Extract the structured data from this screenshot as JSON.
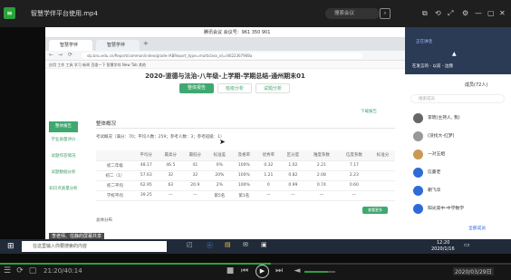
{
  "player": {
    "title": "智慧学伴平台使用.mp4",
    "right_field": "搜索会议",
    "elapsed": "21:20/40:14",
    "volume_pct": 75,
    "progress_pct": 53,
    "stamp": "2020/03/29日"
  },
  "meeting": {
    "title": "腾讯会议 会议号：961 350 901",
    "badge": "正在讲话"
  },
  "browser": {
    "tab1": "智慧学伴",
    "tab2": "智慧学伴",
    "url": "slp.bnu.edu.cn/Report/common/index/grade-/ABReport_type=multiclass_id=/4622367908a",
    "bookmarks": "应用  工作  工具  学习  新闻  百度一下  智慧学伴  New Tab  其他",
    "page_title": "2020-道德与法治-八年级-上学期-学期总结-通州期末01",
    "buttons": [
      "整体报告",
      "班级分析",
      "试题分析"
    ],
    "download": "下载报告",
    "side": [
      "整体报告",
      "学业质量评价",
      "试题作答情况",
      "试题数据分析",
      "知识点质量分析"
    ],
    "section": "整体概况",
    "summary": "考试概况（满分：70；平均人数：259；参考人数：3；参考班级：1）",
    "footer_label": "总体分布",
    "footer_btn": "查看更多"
  },
  "table": {
    "headers": [
      "",
      "平均分",
      "最高分",
      "最低分",
      "标准差",
      "及格率",
      "优秀率",
      "区分度",
      "难度系数",
      "信度系数",
      "标准分"
    ],
    "rows": [
      [
        "初二年级",
        "48.17",
        "46.5",
        "41",
        "0%",
        "100%",
        "0.32",
        "1.02",
        "2.21",
        "7.17"
      ],
      [
        "初二（1）",
        "57.63",
        "32",
        "32",
        "20%",
        "100%",
        "1.21",
        "0.82",
        "2.08",
        "2.23"
      ],
      [
        "初二平均",
        "62.95",
        "63",
        "20.9",
        "2%",
        "100%",
        "0",
        "0.99",
        "0.74",
        "0.60"
      ],
      [
        "学校平均",
        "39.25",
        "—",
        "—",
        "第5名",
        "第1名",
        "—",
        "—",
        "—",
        "—"
      ]
    ]
  },
  "chat": {
    "header": "在发言的 - 以前 - 边我",
    "count": "成员(72人)",
    "search": "搜索成员",
    "members": [
      "李晓(主持人, 我)",
      "(没找大-红梦)",
      "一对五姐",
      "信曼老",
      "朝飞华",
      "阳光高中-中学数学"
    ],
    "more": "全部成员",
    "member_colors": [
      "#666666",
      "#999999",
      "#c89a55",
      "#2f6bd8",
      "#2f6bd8",
      "#2f6bd8"
    ]
  },
  "taskbar": {
    "overlay": "李老师、任静的屏幕共享",
    "search": "在这里输入你要搜索的内容",
    "clock": "12:20",
    "date": "2020/1/16"
  }
}
